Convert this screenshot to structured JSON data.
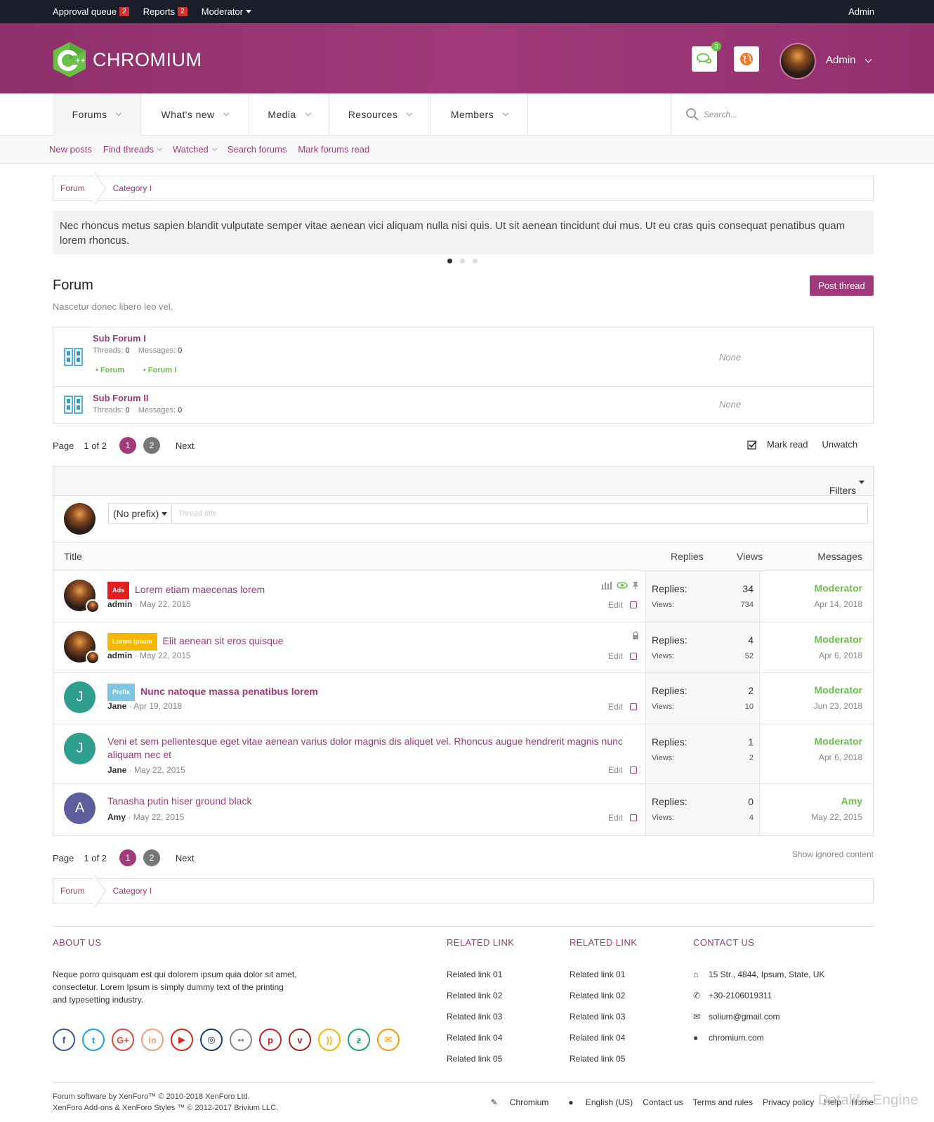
{
  "topbar": {
    "approval_label": "Approval queue",
    "approval_count": "2",
    "reports_label": "Reports",
    "reports_count": "2",
    "moderator_label": "Moderator",
    "admin_label": "Admin"
  },
  "header": {
    "logo_text": "CHROMIUM",
    "conversations_count": "3",
    "user_name": "Admin",
    "brand_color": "#a03a7a"
  },
  "nav": {
    "tabs": [
      {
        "label": "Forums"
      },
      {
        "label": "What's new"
      },
      {
        "label": "Media"
      },
      {
        "label": "Resources"
      },
      {
        "label": "Members"
      }
    ],
    "search_placeholder": "Search..."
  },
  "subnav": {
    "items": [
      "New posts",
      "Find threads",
      "Watched",
      "Search forums",
      "Mark forums read"
    ]
  },
  "breadcrumb": {
    "root": "Forums",
    "current": "Category I"
  },
  "notice": {
    "text": "Nec rhoncus metus sapien blandit vulputate semper vitae aenean vici aliquam nulla nisi quis. Ut sit aenean tincidunt dui mus. Ut eu cras quis consequat penatibus quam lorem rhoncus."
  },
  "forum": {
    "title": "Forum",
    "description": "Nascetur donec libero leo vel.",
    "post_button": "Post thread"
  },
  "subforums": [
    {
      "title": "Sub Forum I",
      "threads_label": "Threads:",
      "threads": "0",
      "messages_label": "Messages:",
      "messages": "0",
      "last": "None",
      "children": [
        "Forum",
        "Forum I"
      ]
    },
    {
      "title": "Sub Forum II",
      "threads_label": "Threads:",
      "threads": "0",
      "messages_label": "Messages:",
      "messages": "0",
      "last": "None",
      "children": []
    }
  ],
  "pager": {
    "label": "Page",
    "of": "1 of 2",
    "pages": [
      "1",
      "2"
    ],
    "next": "Next"
  },
  "actions": {
    "mark_read": "Mark read",
    "unwatch": "Unwatch",
    "show_ignored": "Show ignored content"
  },
  "list": {
    "filters_label": "Filters",
    "prefix_select": "(No prefix)",
    "title_placeholder": "Thread title",
    "col_title": "Title",
    "col_replies": "Replies",
    "col_views": "Views",
    "col_messages": "Messages"
  },
  "threads": [
    {
      "prefix": "Ads",
      "prefix_color": "#e02020",
      "title": "Lorem etiam maecenas lorem",
      "author": "admin",
      "date": "May 22, 2015",
      "replies_label": "Replies:",
      "replies": "34",
      "views_label": "Views:",
      "views": "734",
      "last_user": "Moderator",
      "last_date": "Apr 14, 2018",
      "edit": "Edit"
    },
    {
      "prefix": "Lorem ipsum",
      "prefix_color": "#f5b800",
      "title": "Elit aenean sit eros quisque",
      "author": "admin",
      "date": "May 22, 2015",
      "replies_label": "Replies:",
      "replies": "4",
      "views_label": "Views:",
      "views": "52",
      "last_user": "Moderator",
      "last_date": "Apr 6, 2018",
      "edit": "Edit"
    },
    {
      "prefix": "Prefix",
      "prefix_color": "#7ec4e3",
      "title": "Nunc natoque massa penatibus lorem",
      "author": "Jane",
      "avatar_letter": "J",
      "date": "Apr 19, 2018",
      "replies_label": "Replies:",
      "replies": "2",
      "views_label": "Views:",
      "views": "10",
      "last_user": "Moderator",
      "last_date": "Jun 23, 2018",
      "edit": "Edit"
    },
    {
      "prefix": "",
      "title": "Veni et sem pellentesque eget vitae aenean varius dolor magnis dis aliquet vel. Rhoncus augue hendrerit magnis nunc aliquam nec et",
      "author": "Jane",
      "avatar_letter": "J",
      "date": "May 22, 2015",
      "replies_label": "Replies:",
      "replies": "1",
      "views_label": "Views:",
      "views": "2",
      "last_user": "Moderator",
      "last_date": "Apr 6, 2018",
      "edit": "Edit"
    },
    {
      "prefix": "",
      "title": "Tanasha putin hiser ground black",
      "author": "Amy",
      "avatar_letter": "A",
      "date": "May 22, 2015",
      "replies_label": "Replies:",
      "replies": "0",
      "views_label": "Views:",
      "views": "4",
      "last_user": "Amy",
      "last_date": "May 22, 2015",
      "edit": "Edit"
    }
  ],
  "footer": {
    "about_title": "ABOUT US",
    "about_text": "Neque porro quisquam est qui dolorem ipsum quia dolor sit amet, consectetur. Lorem Ipsum is simply dummy text of the printing and typesetting industry.",
    "related1_title": "RELATED LINK",
    "related1": [
      "Related link 01",
      "Related link 02",
      "Related link 03",
      "Related link 04",
      "Related link 05"
    ],
    "related2_title": "RELATED LINK",
    "related2": [
      "Related link 01",
      "Related link 02",
      "Related link 03",
      "Related link 04",
      "Related link 05"
    ],
    "contact_title": "CONTACT US",
    "address": "15 Str., 4844, Ipsum, State, UK",
    "phone": "+30-2106019311",
    "email": "solium@gmail.com",
    "website": "chromium.com",
    "social": [
      {
        "icon": "facebook-icon",
        "glyph": "f",
        "color": "#3b5998"
      },
      {
        "icon": "twitter-icon",
        "glyph": "t",
        "color": "#1da1f2"
      },
      {
        "icon": "google-plus-icon",
        "glyph": "G+",
        "color": "#dd4b39"
      },
      {
        "icon": "linkedin-icon",
        "glyph": "in",
        "color": "#f0a080"
      },
      {
        "icon": "youtube-icon",
        "glyph": "▶",
        "color": "#e62117"
      },
      {
        "icon": "dribbble-icon",
        "glyph": "◎",
        "color": "#1e3a6e"
      },
      {
        "icon": "flickr-icon",
        "glyph": "••",
        "color": "#888888"
      },
      {
        "icon": "pinterest-icon",
        "glyph": "p",
        "color": "#cb2027"
      },
      {
        "icon": "vimeo-icon",
        "glyph": "v",
        "color": "#b01d1d"
      },
      {
        "icon": "rss-icon",
        "glyph": "))",
        "color": "#f5b800"
      },
      {
        "icon": "deviantart-icon",
        "glyph": "ƶ",
        "color": "#1aa36b"
      },
      {
        "icon": "mail-icon",
        "glyph": "✉",
        "color": "#f5a000"
      }
    ],
    "copyright_1": "Forum software by XenForo™ © 2010-2018 XenForo Ltd.",
    "copyright_2": "XenForo Add-ons & XenForo Styles ™ © 2012-2017 Brivium LLC.",
    "links": [
      "Chromium",
      "English (US)",
      "Contact us",
      "Terms and rules",
      "Privacy policy",
      "Help",
      "Home"
    ],
    "watermark": "Datalife Engine"
  }
}
